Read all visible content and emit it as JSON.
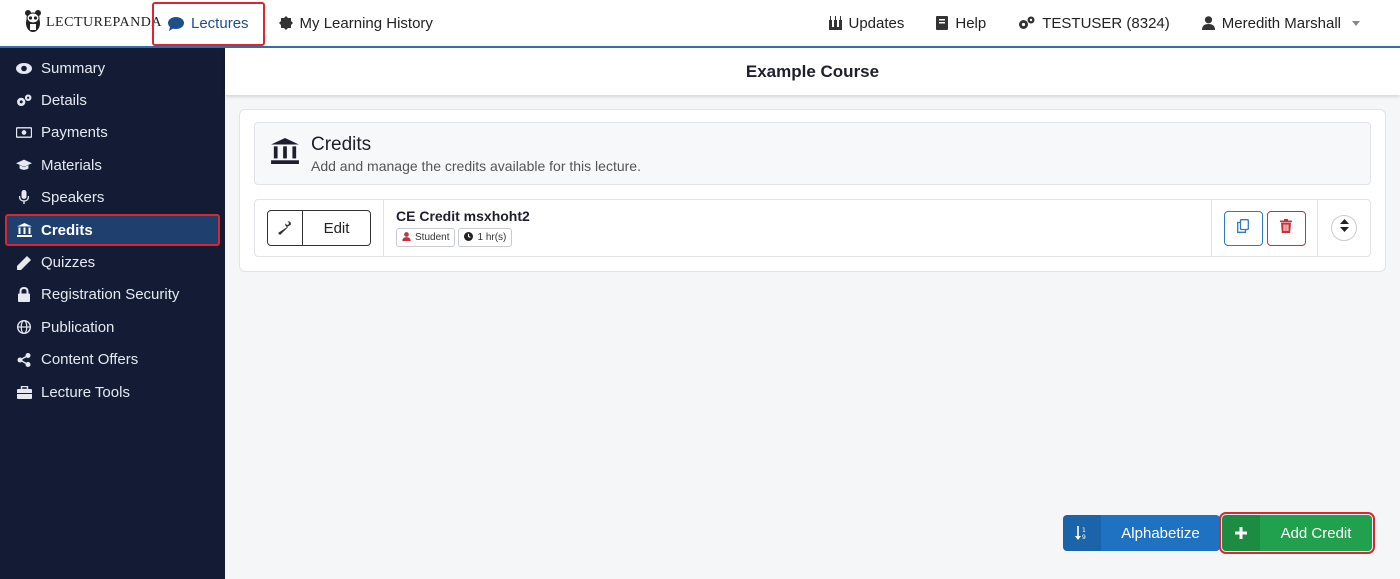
{
  "brand": {
    "name": "LECTUREPANDA"
  },
  "topnav": {
    "lectures": "Lectures",
    "history": "My Learning History",
    "updates": "Updates",
    "help": "Help",
    "org": "TESTUSER (8324)",
    "user": "Meredith Marshall"
  },
  "sidebar": {
    "items": [
      {
        "label": "Summary"
      },
      {
        "label": "Details"
      },
      {
        "label": "Payments"
      },
      {
        "label": "Materials"
      },
      {
        "label": "Speakers"
      },
      {
        "label": "Credits"
      },
      {
        "label": "Quizzes"
      },
      {
        "label": "Registration Security"
      },
      {
        "label": "Publication"
      },
      {
        "label": "Content Offers"
      },
      {
        "label": "Lecture Tools"
      }
    ]
  },
  "main": {
    "course_title": "Example Course",
    "section_title": "Credits",
    "section_subtitle": "Add and manage the credits available for this lecture.",
    "credit": {
      "edit_label": "Edit",
      "name": "CE Credit msxhoht2",
      "badge_audience": "Student",
      "badge_hours": "1 hr(s)"
    },
    "alphabetize_label": "Alphabetize",
    "add_credit_label": "Add Credit"
  },
  "colors": {
    "sidebar_bg": "#131c34",
    "accent_blue": "#1f72c2",
    "accent_green": "#21a04d",
    "danger": "#c8303a",
    "highlight": "#d9262f"
  }
}
